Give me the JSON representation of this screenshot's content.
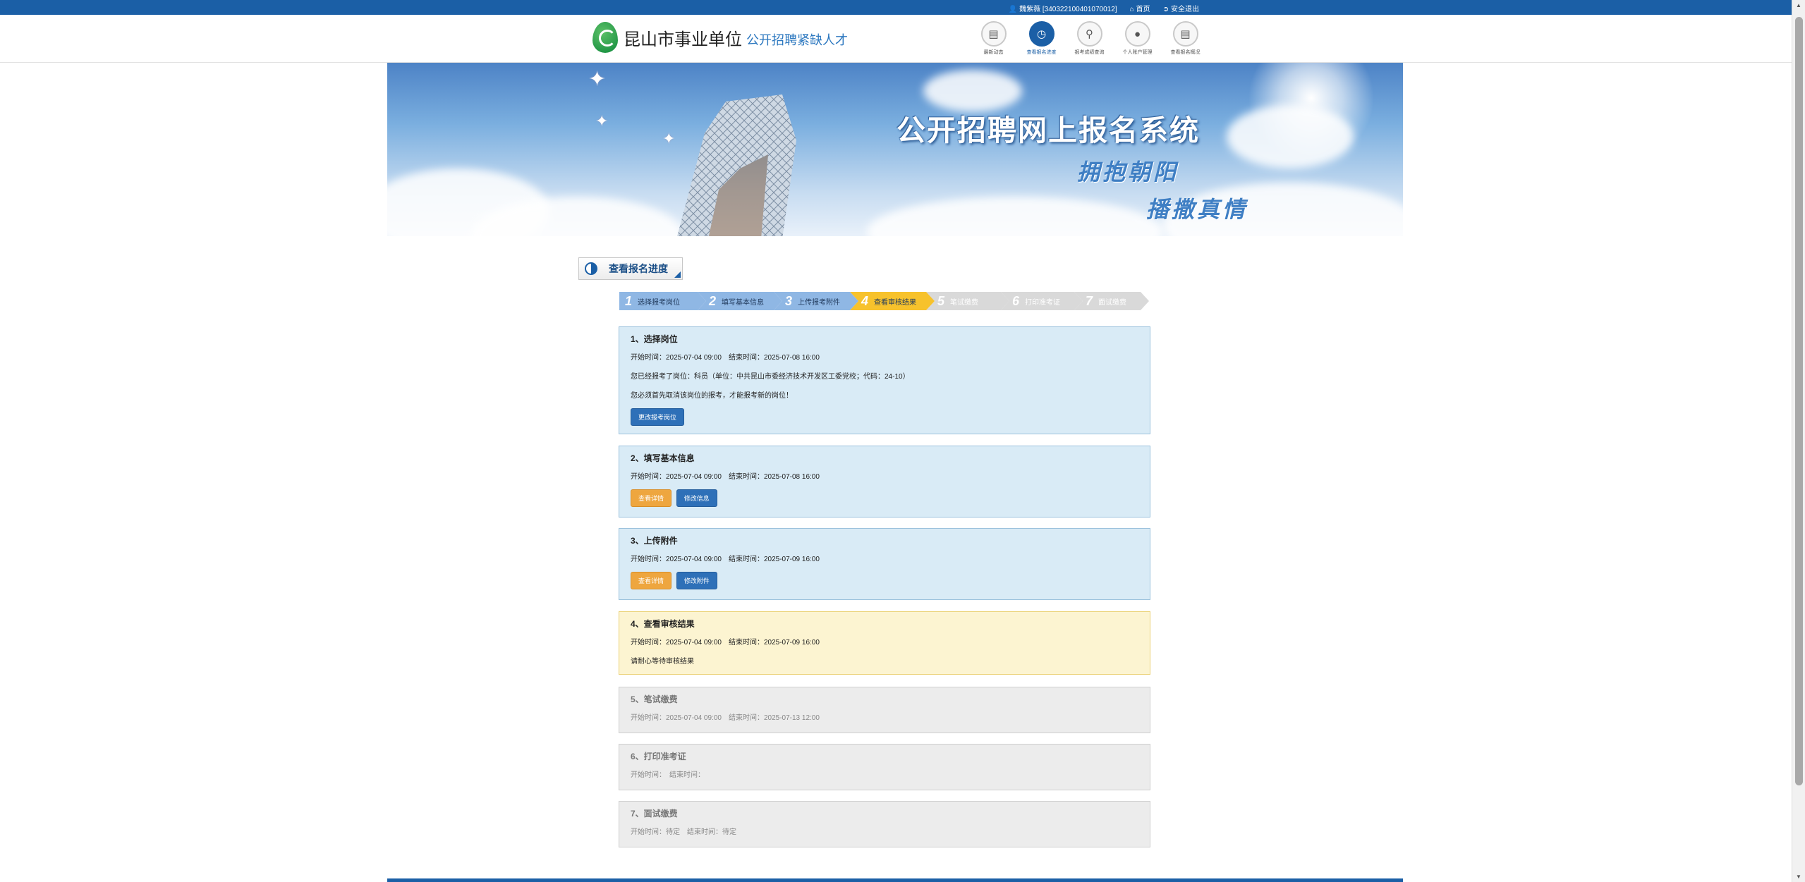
{
  "topbar": {
    "user": "魏紫薇 [340322100401070012]",
    "home": "首页",
    "logout": "安全退出"
  },
  "header": {
    "logo_main": "昆山市事业单位",
    "logo_sub": "公开招聘紧缺人才",
    "nav": [
      {
        "label": "最新动态",
        "icon": "chat-icon"
      },
      {
        "label": "查看报名进度",
        "icon": "progress-icon",
        "active": true
      },
      {
        "label": "报考成绩查询",
        "icon": "search-icon"
      },
      {
        "label": "个人账户管理",
        "icon": "user-icon"
      },
      {
        "label": "查看报名概况",
        "icon": "list-icon"
      }
    ]
  },
  "banner": {
    "title": "公开招聘网上报名系统",
    "sub1": "拥抱朝阳",
    "sub2": "播撒真情"
  },
  "section": {
    "title": "查看报名进度"
  },
  "steps": [
    {
      "num": "1",
      "label": "选择报考岗位",
      "state": "done"
    },
    {
      "num": "2",
      "label": "填写基本信息",
      "state": "done"
    },
    {
      "num": "3",
      "label": "上传报考附件",
      "state": "done"
    },
    {
      "num": "4",
      "label": "查看审核结果",
      "state": "cur"
    },
    {
      "num": "5",
      "label": "笔试缴费",
      "state": "todo"
    },
    {
      "num": "6",
      "label": "打印准考证",
      "state": "todo"
    },
    {
      "num": "7",
      "label": "面试缴费",
      "state": "todo"
    }
  ],
  "cards": {
    "c1": {
      "title": "1、选择岗位",
      "time": "开始时间：2025-07-04 09:00　结束时间：2025-07-08 16:00",
      "line2": "您已经报考了岗位：科员（单位：中共昆山市委经济技术开发区工委党校；代码：24-10）",
      "line3": "您必须首先取消该岗位的报考，才能报考新的岗位！",
      "btn": "更改报考岗位"
    },
    "c2": {
      "title": "2、填写基本信息",
      "time": "开始时间：2025-07-04 09:00　结束时间：2025-07-08 16:00",
      "btn_view": "查看详情",
      "btn_edit": "修改信息"
    },
    "c3": {
      "title": "3、上传附件",
      "time": "开始时间：2025-07-04 09:00　结束时间：2025-07-09 16:00",
      "btn_view": "查看详情",
      "btn_edit": "修改附件"
    },
    "c4": {
      "title": "4、查看审核结果",
      "time": "开始时间：2025-07-04 09:00　结束时间：2025-07-09 16:00",
      "line2": "请耐心等待审核结果"
    },
    "c5": {
      "title": "5、笔试缴费",
      "time": "开始时间：2025-07-04 09:00　结束时间：2025-07-13 12:00"
    },
    "c6": {
      "title": "6、打印准考证",
      "time": "开始时间：　结束时间："
    },
    "c7": {
      "title": "7、面试缴费",
      "time": "开始时间：待定　结束时间：待定"
    }
  },
  "colors": {
    "brand": "#1b5fa6",
    "step_done": "#8fb7e4",
    "step_current": "#f7c22c",
    "step_todo": "#d9d9d9"
  }
}
